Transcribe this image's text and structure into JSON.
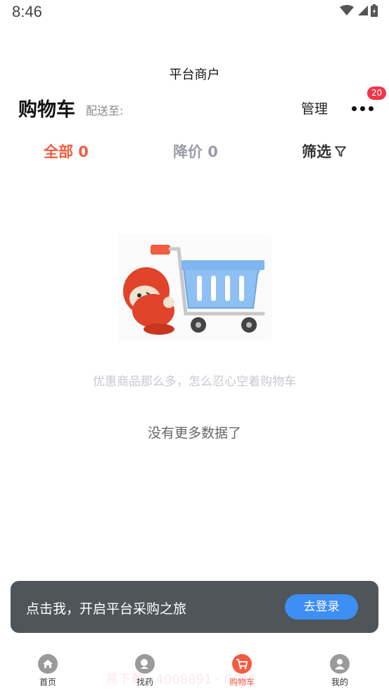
{
  "status_bar": {
    "time": "8:46"
  },
  "page": {
    "platform_title": "平台商户"
  },
  "cart_header": {
    "title": "购物车",
    "deliver_label": "配送至:",
    "manage_label": "管理",
    "message_count": "20"
  },
  "tabs": {
    "all": "全部 0",
    "price_drop": "降价 0",
    "filter": "筛选"
  },
  "empty_state": {
    "tip": "优惠商品那么多，怎么忍心空着购物车",
    "no_more": "没有更多数据了"
  },
  "login_banner": {
    "text": "点击我，开启平台采购之旅",
    "button": "去登录"
  },
  "tabbar": [
    {
      "label": "首页",
      "icon": "home-icon"
    },
    {
      "label": "找药",
      "icon": "find-medicine-icon"
    },
    {
      "label": "购物车",
      "icon": "cart-icon",
      "active": true
    },
    {
      "label": "我的",
      "icon": "profile-icon"
    }
  ],
  "watermark": "易下载 · 4008891 · COM",
  "colors": {
    "accent": "#f25c3f",
    "primary_button": "#3d8ef5",
    "banner_bg": "#4f5558",
    "badge": "#f2364a"
  }
}
